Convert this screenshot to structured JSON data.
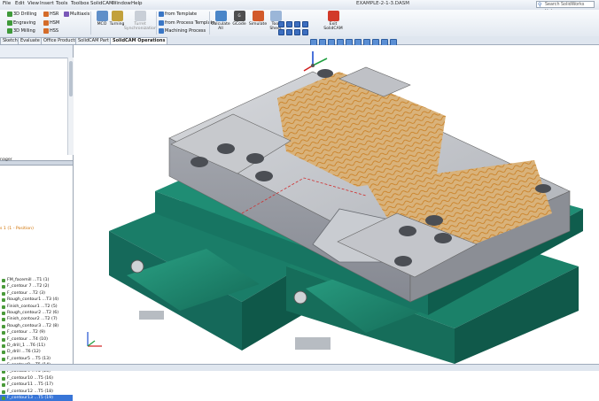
{
  "menu": {
    "items": [
      "File",
      "Edit",
      "View",
      "Insert",
      "Tools",
      "Toolbox",
      "SolidCAM",
      "Window",
      "Help"
    ],
    "doc_title": "EXAMPLE-2-1-3.DASM",
    "help_placeholder": "Search SolidWorks Help"
  },
  "ribbon": {
    "ops": [
      "3D Drilling",
      "Engraving",
      "3D Milling"
    ],
    "modes": [
      "HSR",
      "HSM",
      "HSS"
    ],
    "multiaxis": "Multiaxis",
    "mcd": "MCO",
    "turning": "Turning",
    "turret_sync": "Turret Synchronization",
    "templates": [
      "from Template",
      "from Process Template",
      "Machining Process"
    ],
    "calc_all": "Calculate All",
    "gcode": "GCode",
    "simulate": "Simulate",
    "tool_sheet": "Tool Sheet",
    "exit": "Exit SolidCAM"
  },
  "tabs": [
    "Sketch",
    "Evaluate",
    "Office Products",
    "SolidCAM Part",
    "SolidCAM Operations"
  ],
  "active_tab": "SolidCAM Operations",
  "tree": {
    "manager_label": "nager",
    "mill_label": "s 1 (1 - Position)",
    "operations": [
      "FM_facemill ...T1 (1)",
      "F_contour 7 ...T2 (2)",
      "F_contour ...T2 (3)",
      "Rough_contour1 ...T3 (4)",
      "Finish_contour1 ...T2 (5)",
      "Rough_contour2 ...T2 (6)",
      "Finish_contour2 ...T2 (7)",
      "Rough_contour3 ...T2 (8)",
      "F_contour ...T2 (9)",
      "F_contour ...T4 (10)",
      "D_drill_1 ...T6 (11)",
      "D_drill ...T6 (12)",
      "F_contour5 ...T5 (13)",
      "F_contour8 ...T5 (14)",
      "F_contour9 ...T5 (15)",
      "F_contour10 ...T5 (16)",
      "F_contour11 ...T5 (17)",
      "F_contour12 ...T5 (18)",
      "F_contour13 ...T5 (19)"
    ],
    "selected_index": 18
  },
  "colors": {
    "fixture_green": "#1e8a73",
    "part_gray": "#b7b9bf",
    "toolpath": "#c87a1a",
    "selection_blue": "#3875d7"
  }
}
